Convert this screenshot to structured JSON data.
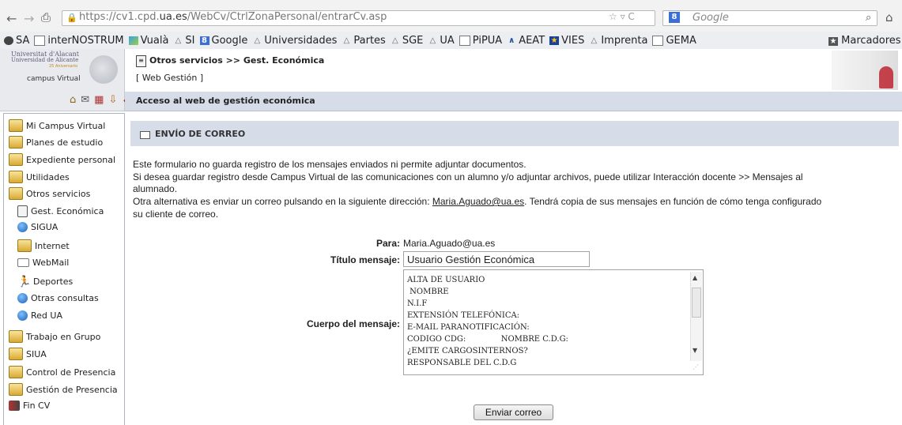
{
  "browser": {
    "url_prefix": "https://cv1.cpd.",
    "url_domain": "ua.es",
    "url_path": "/WebCv/CtrlZonaPersonal/entrarCv.asp",
    "search_engine": "Google",
    "url_actions": "☆ ▿ C",
    "bookmarks": [
      {
        "label": "SA",
        "icon": "globe-icon"
      },
      {
        "label": "interNOSTRUM",
        "icon": "page-icon"
      },
      {
        "label": "Vualà",
        "icon": "vuala-icon"
      },
      {
        "label": "SI",
        "icon": "triangle-icon"
      },
      {
        "label": "Google",
        "icon": "google-icon"
      },
      {
        "label": "Universidades",
        "icon": "triangle-icon"
      },
      {
        "label": "Partes",
        "icon": "triangle-icon"
      },
      {
        "label": "SGE",
        "icon": "triangle-icon"
      },
      {
        "label": "UA",
        "icon": "triangle-icon"
      },
      {
        "label": "PiPUA",
        "icon": "page-icon"
      },
      {
        "label": "AEAT",
        "icon": "aeat-icon"
      },
      {
        "label": "VIES",
        "icon": "eu-flag-icon"
      },
      {
        "label": "Imprenta",
        "icon": "triangle-icon"
      },
      {
        "label": "GEMA",
        "icon": "page-icon"
      }
    ],
    "bookmarks_folder": "Marcadores"
  },
  "header": {
    "logo_line1": "Universitat d'Alacant",
    "logo_line2": "Universidad de Alicante",
    "logo_line3": "25 Aniversario",
    "logo_campus": "campus Virtual",
    "title": "Otros servicios >> Gest. Económica",
    "link": "[ Web Gestión ]",
    "toolbar_text": "Acceso al web de gestión económica"
  },
  "sidebar": {
    "items": [
      {
        "label": "Mi Campus Virtual",
        "icon": "globe-folder-icon"
      },
      {
        "label": "Planes de estudio",
        "icon": "folder-icon"
      },
      {
        "label": "Expediente personal",
        "icon": "folder-icon"
      },
      {
        "label": "Utilidades",
        "icon": "folder-icon"
      },
      {
        "label": "Otros servicios",
        "icon": "folder-open-icon"
      },
      {
        "label": "Gest. Económica",
        "icon": "document-icon"
      },
      {
        "label": "SIGUA",
        "icon": "globe-icon"
      },
      {
        "label": "Internet",
        "icon": "network-icon"
      },
      {
        "label": "WebMail",
        "icon": "mail-icon"
      },
      {
        "label": "Deportes",
        "icon": "runner-icon"
      },
      {
        "label": "Otras consultas",
        "icon": "globe-icon"
      },
      {
        "label": "Red UA",
        "icon": "globe-icon"
      },
      {
        "label": "Trabajo en Grupo",
        "icon": "folder-icon"
      },
      {
        "label": "SIUA",
        "icon": "folder-icon"
      },
      {
        "label": "Control de Presencia",
        "icon": "folder-icon"
      },
      {
        "label": "Gestión de Presencia",
        "icon": "folder-icon"
      },
      {
        "label": "Fin CV",
        "icon": "exit-icon"
      }
    ]
  },
  "main": {
    "section_title": "ENVÍO DE CORREO",
    "paragraph": {
      "line1": "Este formulario no guarda registro de los mensajes enviados ni permite adjuntar documentos.",
      "line2": "Si desea guardar registro desde Campus Virtual de las comunicaciones con un alumno y/o adjuntar archivos, puede utilizar Interacción docente >> Mensajes al",
      "line3": "alumnado.",
      "line4_pre": "Otra alternativa es enviar un correo pulsando en la siguiente dirección: ",
      "line4_link": "Maria.Aguado@ua.es",
      "line4_post": ". Tendrá copia de sus mensajes en función de cómo tenga configurado",
      "line5": "su cliente de correo."
    },
    "form": {
      "para_label": "Para:",
      "para_value": "Maria.Aguado@ua.es",
      "titulo_label": "Título mensaje:",
      "titulo_value": "Usuario Gestión Económica",
      "cuerpo_label": "Cuerpo del mensaje:",
      "cuerpo_lines": [
        "ALTA DE USUARIO",
        " NOMBRE",
        "N.I.F",
        "EXTENSIÓN TELEFÓNICA:",
        "E-MAIL PARANOTIFICACIÓN:",
        "CODIGO CDG:              NOMBRE C.D.G:",
        "¿EMITE CARGOSINTERNOS?",
        "RESPONSABLE DEL C.D.G"
      ],
      "submit_label": "Enviar correo"
    }
  }
}
